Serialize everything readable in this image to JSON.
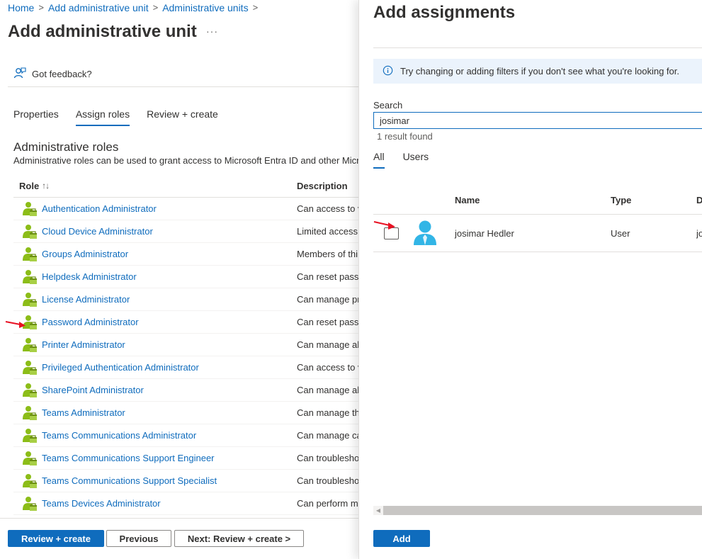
{
  "breadcrumb": [
    {
      "label": "Home"
    },
    {
      "label": "Add administrative unit"
    },
    {
      "label": "Administrative units"
    }
  ],
  "breadcrumb_separator": ">",
  "page_title": "Add administrative unit",
  "more_label": "···",
  "feedback_label": "Got feedback?",
  "tabs": [
    {
      "label": "Properties",
      "active": false
    },
    {
      "label": "Assign roles",
      "active": true
    },
    {
      "label": "Review + create",
      "active": false
    }
  ],
  "section": {
    "title": "Administrative roles",
    "description": "Administrative roles can be used to grant access to Microsoft Entra ID and other Micr"
  },
  "roles_table": {
    "columns": {
      "role": "Role",
      "sort_glyph": "↑↓",
      "description": "Description"
    },
    "rows": [
      {
        "role": "Authentication Administrator",
        "description": "Can access to v"
      },
      {
        "role": "Cloud Device Administrator",
        "description": "Limited access t"
      },
      {
        "role": "Groups Administrator",
        "description": "Members of thi"
      },
      {
        "role": "Helpdesk Administrator",
        "description": "Can reset passw"
      },
      {
        "role": "License Administrator",
        "description": "Can manage pr"
      },
      {
        "role": "Password Administrator",
        "description": "Can reset passw"
      },
      {
        "role": "Printer Administrator",
        "description": "Can manage all"
      },
      {
        "role": "Privileged Authentication Administrator",
        "description": "Can access to v"
      },
      {
        "role": "SharePoint Administrator",
        "description": "Can manage all"
      },
      {
        "role": "Teams Administrator",
        "description": "Can manage th"
      },
      {
        "role": "Teams Communications Administrator",
        "description": "Can manage ca"
      },
      {
        "role": "Teams Communications Support Engineer",
        "description": "Can troublesho"
      },
      {
        "role": "Teams Communications Support Specialist",
        "description": "Can troublesho"
      },
      {
        "role": "Teams Devices Administrator",
        "description": "Can perform m"
      }
    ]
  },
  "footer": {
    "review_create": "Review + create",
    "previous": "Previous",
    "next": "Next: Review + create >"
  },
  "panel": {
    "title": "Add assignments",
    "info_text": "Try changing or adding filters if you don't see what you're looking for.",
    "search_label": "Search",
    "search_value": "josimar",
    "results_text": "1 result found",
    "tabs": [
      {
        "label": "All",
        "active": true
      },
      {
        "label": "Users",
        "active": false
      }
    ],
    "columns": {
      "name": "Name",
      "type": "Type",
      "d": "D"
    },
    "rows": [
      {
        "name": "josimar Hedler",
        "type": "User",
        "d": "jo"
      }
    ],
    "add_label": "Add"
  },
  "colors": {
    "accent": "#0f6cbd",
    "link": "#0f6cbd",
    "info_bg": "#ebf3fc",
    "annotation_arrow": "#e81123",
    "role_icon_green": "#8cbd18",
    "user_avatar": "#32b5e6"
  },
  "icons": {
    "feedback": "feedback-person-icon",
    "info": "info-circle-icon",
    "role": "role-person-icon",
    "user": "user-avatar-icon"
  }
}
